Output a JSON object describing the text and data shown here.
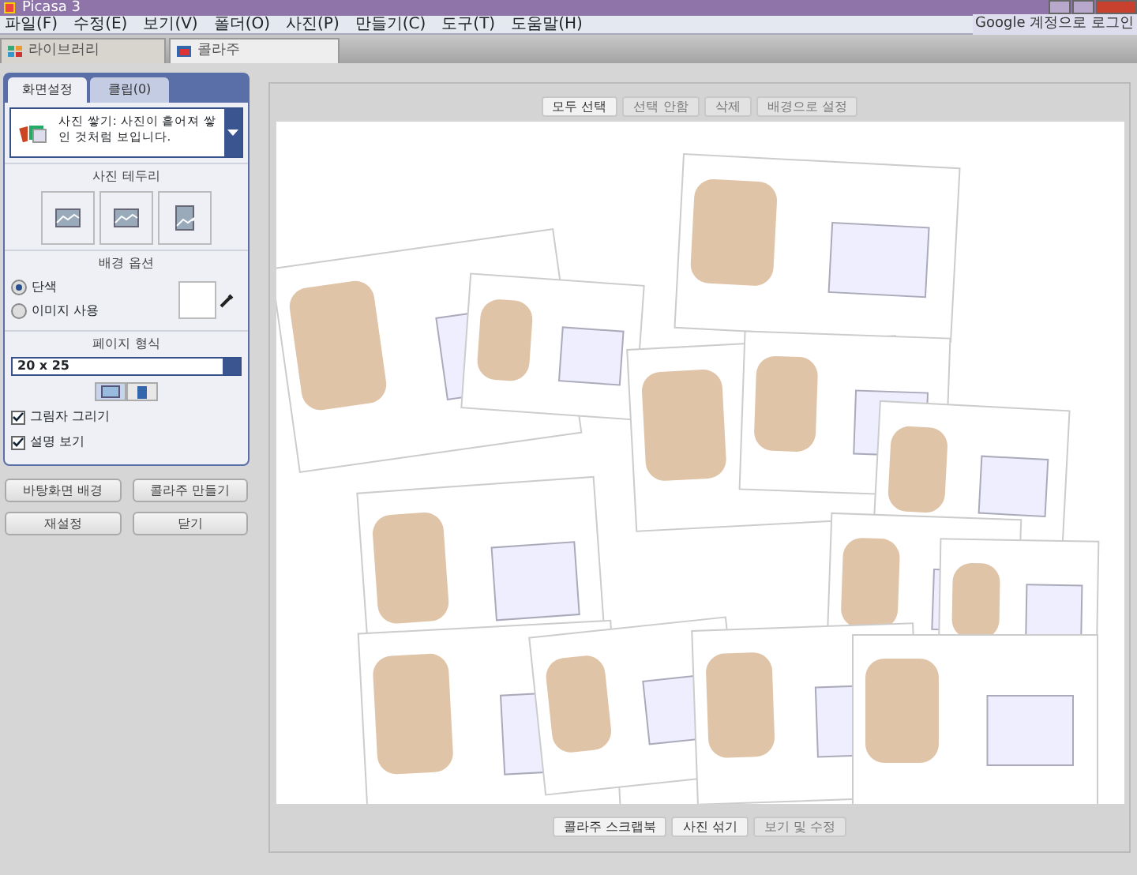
{
  "window": {
    "title": "Picasa 3"
  },
  "menu": [
    "파일(F)",
    "수정(E)",
    "보기(V)",
    "폴더(O)",
    "사진(P)",
    "만들기(C)",
    "도구(T)",
    "도움말(H)"
  ],
  "account_link": "Google 계정으로 로그인",
  "tabs": [
    {
      "label": "라이브러리",
      "selected": false,
      "kind": "library"
    },
    {
      "label": "콜라주",
      "selected": true,
      "kind": "collage"
    }
  ],
  "panel": {
    "tabs": [
      {
        "label": "화면설정",
        "selected": true
      },
      {
        "label": "클립(0)",
        "selected": false
      }
    ],
    "style": "사진 쌓기: 사진이 흩어져 쌓인 것처럼 보입니다.",
    "border_title": "사진 테두리",
    "borders": [
      {
        "kind": "wide"
      },
      {
        "kind": "wide"
      },
      {
        "kind": "tall"
      }
    ],
    "background_title": "배경 옵션",
    "background_options": [
      {
        "label": "단색",
        "selected": true
      },
      {
        "label": "이미지 사용",
        "selected": false
      }
    ],
    "page_title": "페이지 형식",
    "page_format": "20 x 25",
    "orientation": [
      {
        "kind": "landscape",
        "selected": true
      },
      {
        "kind": "portrait",
        "selected": false
      }
    ],
    "checkboxes": [
      {
        "label": "그림자 그리기",
        "checked": true
      },
      {
        "label": "설명 보기",
        "checked": true
      }
    ],
    "buttons": [
      "바탕화면 배경",
      "콜라주 만들기",
      "재설정",
      "닫기"
    ]
  },
  "toolbar": [
    {
      "label": "모두 선택",
      "disabled": false
    },
    {
      "label": "선택 안함",
      "disabled": true
    },
    {
      "label": "삭제",
      "disabled": true
    },
    {
      "label": "배경으로 설정",
      "disabled": true
    }
  ],
  "bottom_toolbar": [
    {
      "label": "콜라주 스크랩북",
      "disabled": false
    },
    {
      "label": "사진 섞기",
      "disabled": false
    },
    {
      "label": "보기 및 수정",
      "disabled": true
    }
  ]
}
